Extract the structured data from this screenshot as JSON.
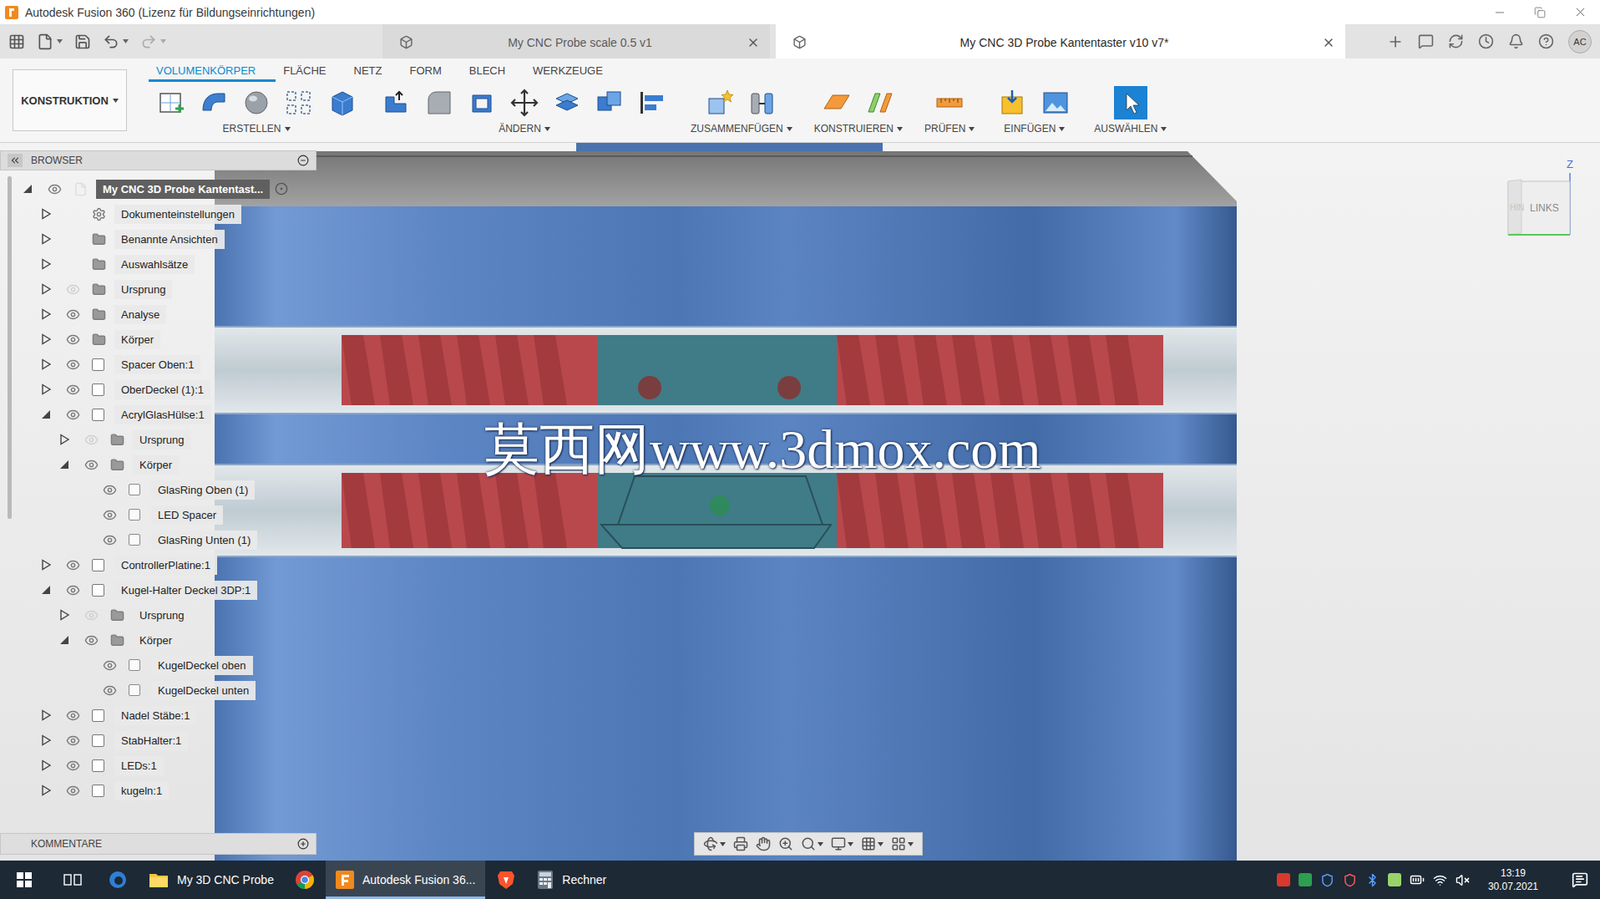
{
  "window": {
    "title": "Autodesk Fusion 360 (Lizenz für Bildungseinrichtungen)"
  },
  "doc_tabs": [
    {
      "label": "My CNC Probe scale 0.5 v1",
      "selected": false
    },
    {
      "label": "My CNC 3D Probe Kantentaster v10 v7*",
      "selected": true
    }
  ],
  "user": {
    "initials": "AC"
  },
  "workspace": {
    "label": "KONSTRUKTION"
  },
  "ribbon_tabs": [
    {
      "label": "VOLUMENKÖRPER",
      "selected": true
    },
    {
      "label": "FLÄCHE",
      "selected": false
    },
    {
      "label": "NETZ",
      "selected": false
    },
    {
      "label": "FORM",
      "selected": false
    },
    {
      "label": "BLECH",
      "selected": false
    },
    {
      "label": "WERKZEUGE",
      "selected": false
    }
  ],
  "tool_groups": [
    {
      "label": "ERSTELLEN",
      "active": false,
      "tools": [
        {
          "kind": "sketch"
        },
        {
          "kind": "extrude"
        },
        {
          "kind": "revolve"
        },
        {
          "kind": "pattern"
        },
        {
          "kind": "box"
        }
      ]
    },
    {
      "label": "ÄNDERN",
      "active": false,
      "tools": [
        {
          "kind": "press-pull"
        },
        {
          "kind": "fillet"
        },
        {
          "kind": "shell"
        },
        {
          "kind": "move"
        },
        {
          "kind": "combine"
        },
        {
          "kind": "replace"
        },
        {
          "kind": "align"
        }
      ]
    },
    {
      "label": "ZUSAMMENFÜGEN",
      "active": false,
      "tools": [
        {
          "kind": "new-component"
        },
        {
          "kind": "joint"
        }
      ]
    },
    {
      "label": "KONSTRUIEREN",
      "active": false,
      "tools": [
        {
          "kind": "plane"
        },
        {
          "kind": "axis"
        }
      ]
    },
    {
      "label": "PRÜFEN",
      "active": false,
      "tools": [
        {
          "kind": "measure"
        }
      ]
    },
    {
      "label": "EINFÜGEN",
      "active": false,
      "tools": [
        {
          "kind": "insert-svg"
        },
        {
          "kind": "decal"
        }
      ]
    },
    {
      "label": "AUSWÄHLEN",
      "active": true,
      "tools": [
        {
          "kind": "select"
        }
      ]
    }
  ],
  "browser": {
    "title": "BROWSER",
    "items": [
      {
        "label": "My CNC 3D Probe Kantentast...",
        "level": 0,
        "expandable": true,
        "expanded": true,
        "visibility": "shown",
        "kind": "root"
      },
      {
        "label": "Dokumenteinstellungen",
        "level": 1,
        "expandable": true,
        "expanded": false,
        "visibility": "none",
        "kind": "settings"
      },
      {
        "label": "Benannte Ansichten",
        "level": 1,
        "expandable": true,
        "expanded": false,
        "visibility": "none",
        "kind": "folder"
      },
      {
        "label": "Auswahlsätze",
        "level": 1,
        "expandable": true,
        "expanded": false,
        "visibility": "none",
        "kind": "folder"
      },
      {
        "label": "Ursprung",
        "level": 1,
        "expandable": true,
        "expanded": false,
        "visibility": "hidden",
        "kind": "folder"
      },
      {
        "label": "Analyse",
        "level": 1,
        "expandable": true,
        "expanded": false,
        "visibility": "shown",
        "kind": "folder"
      },
      {
        "label": "Körper",
        "level": 1,
        "expandable": true,
        "expanded": false,
        "visibility": "shown",
        "kind": "folder"
      },
      {
        "label": "Spacer Oben:1",
        "level": 1,
        "expandable": true,
        "expanded": false,
        "visibility": "shown",
        "kind": "component"
      },
      {
        "label": "OberDeckel (1):1",
        "level": 1,
        "expandable": true,
        "expanded": false,
        "visibility": "shown",
        "kind": "component"
      },
      {
        "label": "AcrylGlasHülse:1",
        "level": 1,
        "expandable": true,
        "expanded": true,
        "visibility": "shown",
        "kind": "component"
      },
      {
        "label": "Ursprung",
        "level": 2,
        "expandable": true,
        "expanded": false,
        "visibility": "hidden",
        "kind": "folder"
      },
      {
        "label": "Körper",
        "level": 2,
        "expandable": true,
        "expanded": true,
        "visibility": "shown",
        "kind": "folder"
      },
      {
        "label": "GlasRing Oben (1)",
        "level": 3,
        "expandable": false,
        "expanded": false,
        "visibility": "shown",
        "kind": "body"
      },
      {
        "label": "LED Spacer",
        "level": 3,
        "expandable": false,
        "expanded": false,
        "visibility": "shown",
        "kind": "body"
      },
      {
        "label": "GlasRing Unten (1)",
        "level": 3,
        "expandable": false,
        "expanded": false,
        "visibility": "shown",
        "kind": "body"
      },
      {
        "label": "ControllerPlatine:1",
        "level": 1,
        "expandable": true,
        "expanded": false,
        "visibility": "shown",
        "kind": "component"
      },
      {
        "label": "Kugel-Halter Deckel 3DP:1",
        "level": 1,
        "expandable": true,
        "expanded": true,
        "visibility": "shown",
        "kind": "component"
      },
      {
        "label": "Ursprung",
        "level": 2,
        "expandable": true,
        "expanded": false,
        "visibility": "hidden",
        "kind": "folder"
      },
      {
        "label": "Körper",
        "level": 2,
        "expandable": true,
        "expanded": true,
        "visibility": "shown",
        "kind": "folder"
      },
      {
        "label": "KugelDeckel oben",
        "level": 3,
        "expandable": false,
        "expanded": false,
        "visibility": "shown",
        "kind": "body"
      },
      {
        "label": "KugelDeckel unten",
        "level": 3,
        "expandable": false,
        "expanded": false,
        "visibility": "shown",
        "kind": "body"
      },
      {
        "label": "Nadel Stäbe:1",
        "level": 1,
        "expandable": true,
        "expanded": false,
        "visibility": "shown",
        "kind": "component"
      },
      {
        "label": "StabHalter:1",
        "level": 1,
        "expandable": true,
        "expanded": false,
        "visibility": "shown",
        "kind": "component"
      },
      {
        "label": "LEDs:1",
        "level": 1,
        "expandable": true,
        "expanded": false,
        "visibility": "shown",
        "kind": "component"
      },
      {
        "label": "kugeln:1",
        "level": 1,
        "expandable": true,
        "expanded": false,
        "visibility": "shown",
        "kind": "component"
      }
    ]
  },
  "comments": {
    "label": "KOMMENTARE"
  },
  "viewcube": {
    "face": "LINKS",
    "side": "HIN",
    "axis": "Z"
  },
  "watermark": "莫西网www.3dmox.com",
  "taskbar": {
    "items": [
      {
        "label": "",
        "kind": "edge",
        "active": false
      },
      {
        "label": "My 3D CNC Probe",
        "kind": "folder",
        "active": false
      },
      {
        "label": "",
        "kind": "chrome",
        "active": false
      },
      {
        "label": "Autodesk Fusion 36...",
        "kind": "fusion",
        "active": true
      },
      {
        "label": "",
        "kind": "brave",
        "active": false
      },
      {
        "label": "Rechner",
        "kind": "calculator",
        "active": false
      }
    ],
    "clock": {
      "time": "13:19",
      "date": "30.07.2021"
    }
  }
}
